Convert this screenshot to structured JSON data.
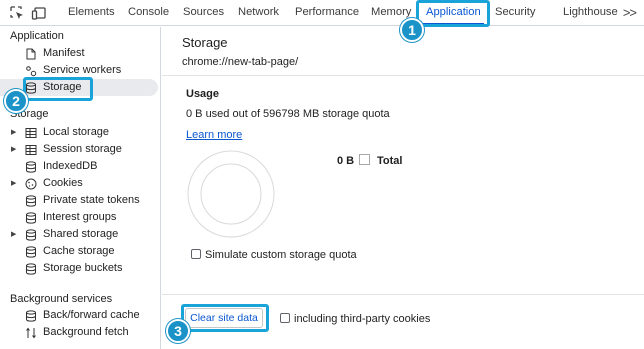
{
  "toolbar": {
    "tabs": [
      "Elements",
      "Console",
      "Sources",
      "Network",
      "Performance",
      "Memory",
      "Application",
      "Security",
      "Lighthouse"
    ],
    "active_tab": "Application",
    "overflow": ">>"
  },
  "sidebar": {
    "application": {
      "title": "Application",
      "items": [
        {
          "label": "Manifest",
          "icon": "document-icon"
        },
        {
          "label": "Service workers",
          "icon": "gear-icon"
        },
        {
          "label": "Storage",
          "icon": "database-icon",
          "selected": true
        }
      ]
    },
    "storage": {
      "title": "Storage",
      "items": [
        {
          "label": "Local storage",
          "icon": "table-icon",
          "expandable": true
        },
        {
          "label": "Session storage",
          "icon": "table-icon",
          "expandable": true
        },
        {
          "label": "IndexedDB",
          "icon": "database-icon"
        },
        {
          "label": "Cookies",
          "icon": "cookie-icon",
          "expandable": true
        },
        {
          "label": "Private state tokens",
          "icon": "database-icon"
        },
        {
          "label": "Interest groups",
          "icon": "database-icon"
        },
        {
          "label": "Shared storage",
          "icon": "database-icon",
          "expandable": true
        },
        {
          "label": "Cache storage",
          "icon": "database-icon"
        },
        {
          "label": "Storage buckets",
          "icon": "database-icon"
        }
      ]
    },
    "background": {
      "title": "Background services",
      "items": [
        {
          "label": "Back/forward cache",
          "icon": "database-icon"
        },
        {
          "label": "Background fetch",
          "icon": "sync-arrows-icon"
        }
      ]
    }
  },
  "main": {
    "title": "Storage",
    "url": "chrome://new-tab-page/",
    "usage": {
      "title": "Usage",
      "text": "0 B used out of 596798 MB storage quota",
      "learn_more": "Learn more",
      "legend_value": "0 B",
      "legend_label": "Total"
    },
    "simulate_label": "Simulate custom storage quota",
    "clear_button": "Clear site data",
    "third_party_label": "including third-party cookies"
  },
  "callouts": [
    "1",
    "2",
    "3"
  ],
  "colors": {
    "accent": "#0b57d0",
    "callout": "#1aa3d9",
    "badge": "#1b93c8"
  }
}
